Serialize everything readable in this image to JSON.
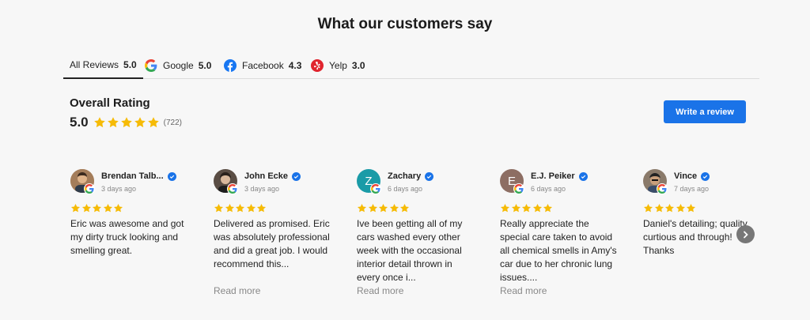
{
  "heading": "What our customers say",
  "tabs": [
    {
      "label": "All Reviews",
      "score": "5.0",
      "icon": "none"
    },
    {
      "label": "Google",
      "score": "5.0",
      "icon": "google-icon"
    },
    {
      "label": "Facebook",
      "score": "4.3",
      "icon": "facebook-icon"
    },
    {
      "label": "Yelp",
      "score": "3.0",
      "icon": "yelp-icon"
    }
  ],
  "overall": {
    "label": "Overall Rating",
    "value": "5.0",
    "stars": 5,
    "count": "(722)"
  },
  "write_review_label": "Write a review",
  "reviews": [
    {
      "name": "Brendan Talb...",
      "date": "3 days ago",
      "stars": 5,
      "text": "Eric was awesome and got my dirty truck looking and smelling great.",
      "read_more": ""
    },
    {
      "name": "John Ecke",
      "date": "3 days ago",
      "stars": 5,
      "text": "Delivered as promised. Eric was absolutely professional and did a great job. I would recommend this...",
      "read_more": "Read more"
    },
    {
      "name": "Zachary",
      "date": "6 days ago",
      "stars": 5,
      "text": "Ive been getting all of my cars washed every other week with the occasional interior detail thrown in every once i...",
      "read_more": "Read more",
      "avatar_letter": "Z"
    },
    {
      "name": "E.J. Peiker",
      "date": "6 days ago",
      "stars": 5,
      "text": "Really appreciate the special care taken to avoid all chemical smells in Amy's car due to her chronic lung issues....",
      "read_more": "Read more",
      "avatar_letter": "E"
    },
    {
      "name": "Vince",
      "date": "7 days ago",
      "stars": 5,
      "text": "Daniel's detailing; quality, curtious and through! Thanks",
      "read_more": ""
    }
  ],
  "colors": {
    "star": "#f6bb06",
    "button": "#1a73e8",
    "verified": "#1a73e8",
    "zachary_avatar": "#1a9ba7",
    "ej_avatar": "#8d6e63"
  }
}
